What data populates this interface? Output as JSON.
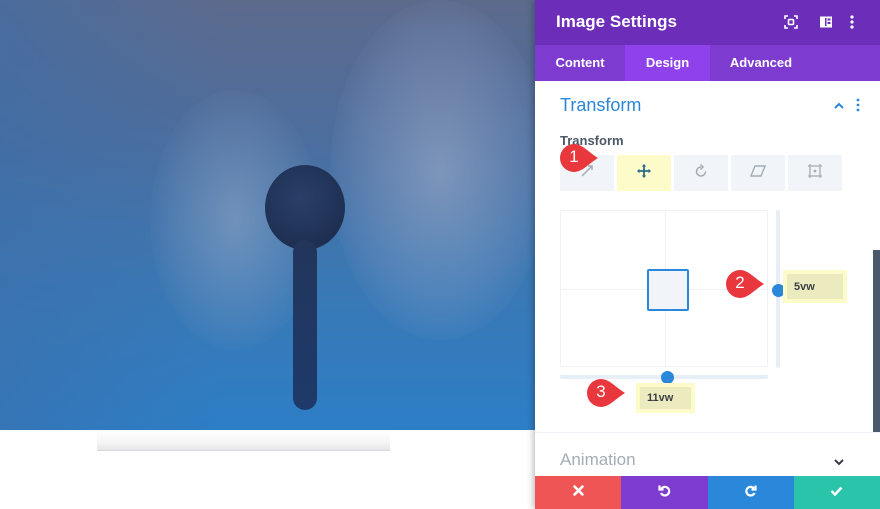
{
  "canvas": {
    "image_description": "Young girl holding an eye occluder with an optometrist, blue gradient overlay"
  },
  "panel": {
    "title": "Image Settings",
    "header_icons": [
      "expand-icon",
      "split-view-icon",
      "more-vert-icon"
    ],
    "tabs": [
      {
        "label": "Content",
        "active": false
      },
      {
        "label": "Design",
        "active": true
      },
      {
        "label": "Advanced",
        "active": false
      }
    ],
    "section": {
      "title": "Transform",
      "expanded": true,
      "field_label": "Transform",
      "transform_tabs": [
        {
          "name": "scale",
          "icon": "scale-icon",
          "active": false
        },
        {
          "name": "translate",
          "icon": "move-icon",
          "active": true
        },
        {
          "name": "rotate",
          "icon": "rotate-icon",
          "active": false
        },
        {
          "name": "skew",
          "icon": "skew-icon",
          "active": false
        },
        {
          "name": "origin",
          "icon": "origin-icon",
          "active": false
        }
      ],
      "translate_y": "5vw",
      "translate_x": "11vw"
    },
    "collapsed_section": {
      "title": "Animation"
    },
    "annotations": [
      "1",
      "2",
      "3"
    ],
    "footer_buttons": [
      {
        "name": "discard",
        "icon": "close-icon",
        "color": "#ef5555"
      },
      {
        "name": "undo",
        "icon": "undo-icon",
        "color": "#7e3bd0"
      },
      {
        "name": "redo",
        "icon": "redo-icon",
        "color": "#2b87da"
      },
      {
        "name": "save",
        "icon": "check-icon",
        "color": "#29c4a9"
      }
    ]
  },
  "colors": {
    "header": "#6c2eb9",
    "tabs": "#7e3bd0",
    "active_tab": "#8f42ec",
    "accent": "#2b87da",
    "highlight": "#fdfbc9",
    "badge": "#e8373d"
  }
}
